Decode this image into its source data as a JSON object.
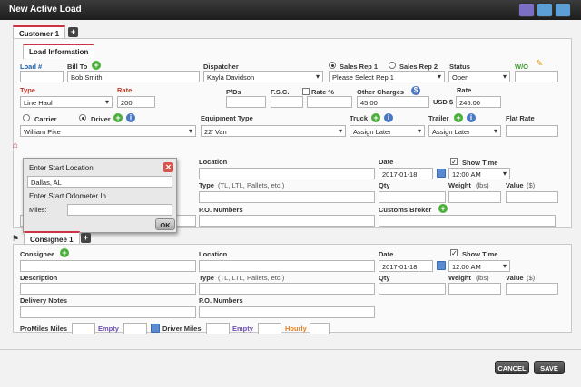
{
  "window": {
    "title": "New Active Load"
  },
  "tabs": {
    "customer": "Customer 1",
    "load_info": "Load Information",
    "consignee": "Consignee 1"
  },
  "load": {
    "load_no_label": "Load #",
    "load_no": "",
    "bill_to_label": "Bill To",
    "bill_to": "Bob Smith",
    "dispatcher_label": "Dispatcher",
    "dispatcher": "Kayla Davidson",
    "sales_rep1_label": "Sales Rep 1",
    "sales_rep2_label": "Sales Rep 2",
    "sales_rep": "Please Select Rep 1",
    "status_label": "Status",
    "status": "Open",
    "wo_label": "W/O",
    "type_label": "Type",
    "type": "Line Haul",
    "rate_label": "Rate",
    "rate": "200.",
    "pds_label": "P/Ds",
    "fsc_label": "F.S.C.",
    "rate_pct_label": "Rate %",
    "other_charges_label": "Other Charges",
    "other_charges": "45.00",
    "usd_label": "USD $",
    "rate2_label": "Rate",
    "total": "245.00",
    "carrier_label": "Carrier",
    "driver_label": "Driver",
    "driver": "William Pike",
    "equipment_label": "Equipment Type",
    "equipment": "22' Van",
    "truck_label": "Truck",
    "truck": "Assign Later",
    "trailer_label": "Trailer",
    "trailer": "Assign Later",
    "flat_rate_label": "Flat Rate"
  },
  "shipper": {
    "location_label": "Location",
    "date_label": "Date",
    "date": "2017-01-18",
    "show_time_label": "Show Time",
    "time": "12:00 AM",
    "type_label": "Type",
    "type_hint": "(TL, LTL, Pallets, etc.)",
    "qty_label": "Qty",
    "weight_label": "Weight",
    "weight_unit": "(lbs)",
    "value_label": "Value",
    "value_unit": "($)",
    "po_label": "P.O. Numbers",
    "customs_label": "Customs Broker"
  },
  "popup": {
    "title": "Enter Start Location",
    "location": "Dallas, AL",
    "odometer_label": "Enter Start Odometer In",
    "miles_label": "Miles:",
    "ok": "OK"
  },
  "consignee": {
    "consignee_label": "Consignee",
    "location_label": "Location",
    "date_label": "Date",
    "date": "2017-01-18",
    "show_time_label": "Show Time",
    "time": "12:00 AM",
    "description_label": "Description",
    "type_label": "Type",
    "type_hint": "(TL, LTL, Pallets, etc.)",
    "qty_label": "Qty",
    "weight_label": "Weight",
    "weight_unit": "(lbs)",
    "value_label": "Value",
    "value_unit": "($)",
    "delivery_notes_label": "Delivery Notes",
    "po_label": "P.O. Numbers"
  },
  "miles": {
    "promiles_label": "ProMiles Miles",
    "empty_label": "Empty",
    "driver_miles_label": "Driver Miles",
    "empty2_label": "Empty",
    "hourly_label": "Hourly"
  },
  "buttons": {
    "cancel": "CANCEL",
    "save": "SAVE"
  },
  "icons": [
    "help-icon",
    "minimize-icon",
    "close-icon",
    "plus-icon",
    "info-icon",
    "calendar-icon",
    "house-icon",
    "flag-icon"
  ],
  "colors": {
    "titlebar": "#2a2a2a",
    "label_blue": "#1f5fa8",
    "label_red": "#c0392b",
    "accent_green": "#4caf3c"
  }
}
